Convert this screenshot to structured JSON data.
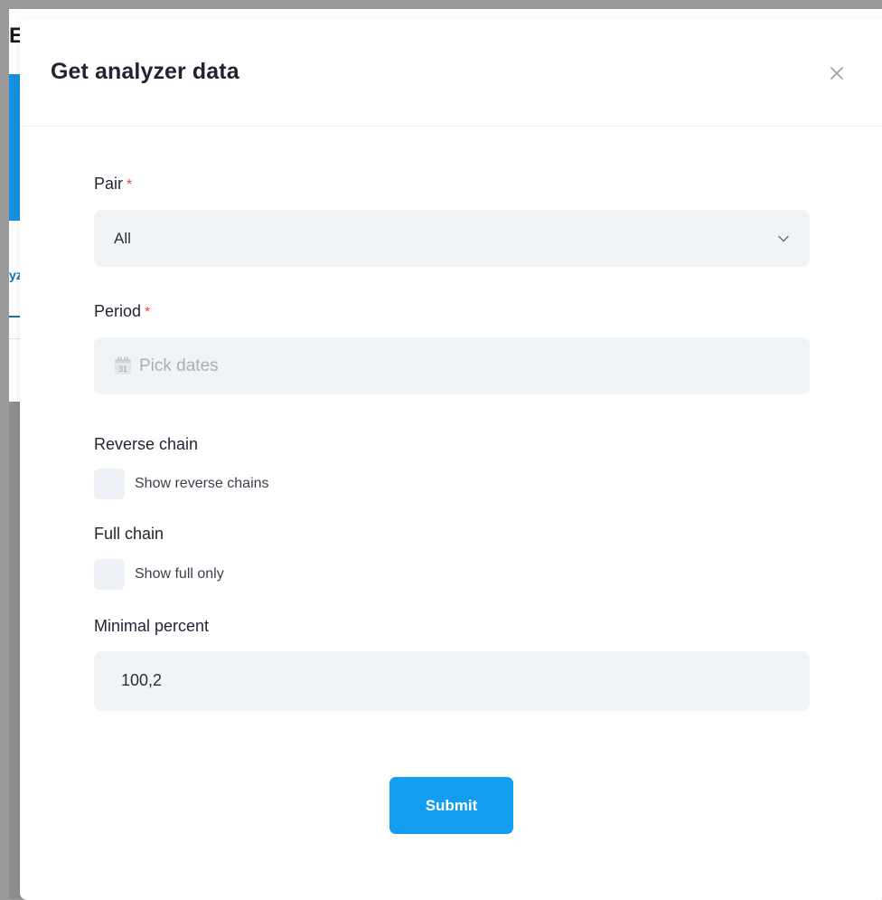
{
  "background": {
    "title_fragment": "E",
    "tab_fragment": "yz"
  },
  "modal": {
    "title": "Get analyzer data",
    "close_icon": "close-icon"
  },
  "form": {
    "pair": {
      "label": "Pair",
      "required_mark": "*",
      "value": "All",
      "icon": "chevron-down-icon"
    },
    "period": {
      "label": "Period",
      "required_mark": "*",
      "placeholder": "Pick dates",
      "icon": "calendar-icon",
      "icon_text": "31"
    },
    "reverse_chain": {
      "label": "Reverse chain",
      "checkbox_label": "Show reverse chains",
      "checked": false
    },
    "full_chain": {
      "label": "Full chain",
      "checkbox_label": "Show full only",
      "checked": false
    },
    "minimal_percent": {
      "label": "Minimal percent",
      "value": "100,2"
    },
    "submit_label": "Submit"
  },
  "colors": {
    "accent": "#129df0",
    "required": "#e5484d",
    "input_bg": "#f1f4f7",
    "overlay": "#9a9a9a"
  }
}
